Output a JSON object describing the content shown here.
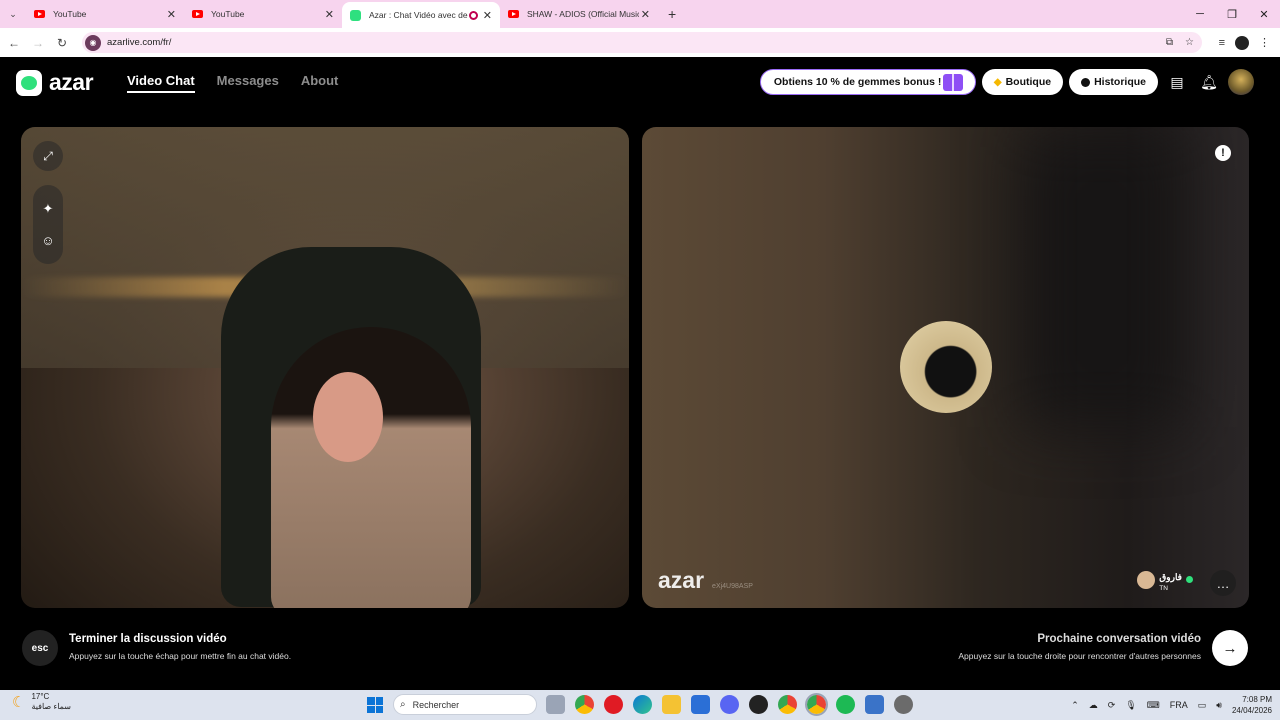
{
  "browser": {
    "tabs": [
      {
        "title": "YouTube",
        "favicon": "youtube-icon",
        "active": false
      },
      {
        "title": "YouTube",
        "favicon": "youtube-icon",
        "active": false
      },
      {
        "title": "Azar : Chat Vidéo avec de n",
        "favicon": "azar-icon",
        "active": true
      },
      {
        "title": "SHAW - ADIOS (Official Music V",
        "favicon": "youtube-icon",
        "active": false
      }
    ],
    "new_tab": "+",
    "url": "azarlive.com/fr/"
  },
  "app": {
    "logo_text": "azar",
    "nav": [
      {
        "label": "Video Chat",
        "active": true
      },
      {
        "label": "Messages",
        "active": false
      },
      {
        "label": "About",
        "active": false
      }
    ],
    "promo_label": "Obtiens 10 % de gemmes bonus !",
    "shop_label": "Boutique",
    "history_label": "Historique",
    "colors": {
      "accent_green": "#2fe07c",
      "promo_border": "#9b6cf6"
    }
  },
  "remote": {
    "watermark": "azar",
    "code": "eXj4U98ASP",
    "peer_name": "فاروق",
    "peer_country": "TN"
  },
  "hints": {
    "esc_key": "esc",
    "end_title": "Terminer la discussion vidéo",
    "end_sub": "Appuyez sur la touche échap pour mettre fin au chat vidéo.",
    "next_title": "Prochaine conversation vidéo",
    "next_sub": "Appuyez sur la touche droite pour rencontrer d'autres personnes",
    "next_arrow": "→"
  },
  "taskbar": {
    "temp": "17°C",
    "weather": "سماء صافية",
    "search_placeholder": "Rechercher",
    "lang": "FRA",
    "time": "7:08 PM",
    "date": "24/04/2026"
  }
}
